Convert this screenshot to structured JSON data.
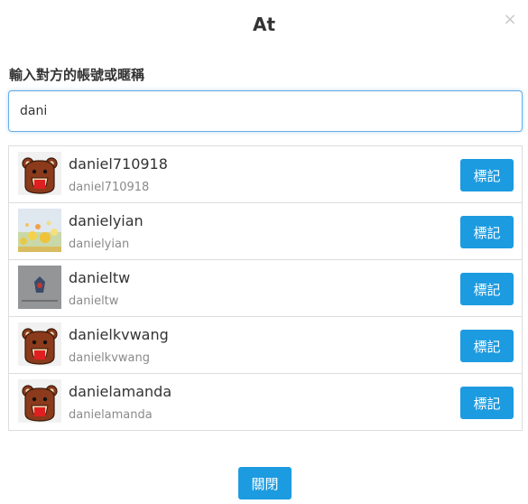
{
  "modal": {
    "title": "At",
    "close_icon": "×",
    "close_button_label": "關閉"
  },
  "search": {
    "label": "輸入對方的帳號或暱稱",
    "value": "dani"
  },
  "users": [
    {
      "name": "daniel710918",
      "handle": "daniel710918",
      "button_label": "標記",
      "avatar": "bear-avatar"
    },
    {
      "name": "danielyian",
      "handle": "danielyian",
      "button_label": "標記",
      "avatar": "flower-photo-avatar"
    },
    {
      "name": "danieltw",
      "handle": "danieltw",
      "button_label": "標記",
      "avatar": "gray-photo-avatar"
    },
    {
      "name": "danielkvwang",
      "handle": "danielkvwang",
      "button_label": "標記",
      "avatar": "bear-avatar"
    },
    {
      "name": "danielamanda",
      "handle": "danielamanda",
      "button_label": "標記",
      "avatar": "bear-avatar"
    }
  ],
  "colors": {
    "accent": "#1c9be0",
    "input_focus_border": "#66afe9",
    "list_border": "#dddddd",
    "bear_brown": "#8b3a1c",
    "bear_mouth_red": "#e02020"
  }
}
